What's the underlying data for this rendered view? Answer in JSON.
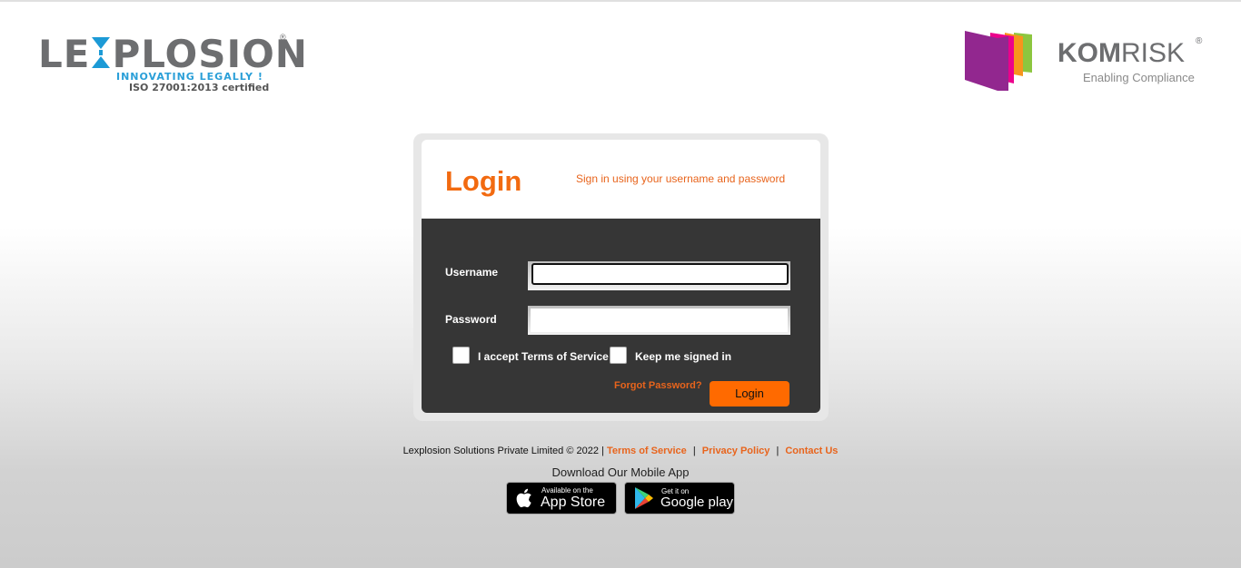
{
  "branding": {
    "lexplosion": {
      "word_left": "LE",
      "word_right": "PLOSION",
      "registered": "®",
      "tagline": "INNOVATING LEGALLY !",
      "certification": "ISO 27001:2013 certified"
    },
    "komrisk": {
      "word_bold": "KOM",
      "word_regular": "RISK",
      "registered": "®",
      "tagline": "Enabling Compliance"
    }
  },
  "login": {
    "title": "Login",
    "subtitle": "Sign in using your username and password",
    "username_label": "Username",
    "username_value": "",
    "password_label": "Password",
    "password_value": "",
    "accept_terms_label": "I accept Terms of Service",
    "keep_signed_in_label": "Keep me signed in",
    "forgot_password": "Forgot Password?",
    "submit_label": "Login"
  },
  "footer": {
    "copyright": "Lexplosion Solutions Private Limited © 2022 |",
    "terms": "Terms of Service",
    "privacy": "Privacy Policy",
    "contact": "Contact Us",
    "separator": "|"
  },
  "mobile": {
    "heading": "Download Our Mobile App",
    "app_store_small": "Available on the",
    "app_store_big": "App Store",
    "google_small": "Get it on",
    "google_big": "Google play"
  },
  "colors": {
    "accent": "#f26a10",
    "button": "#ff6a00",
    "panel": "#363636"
  },
  "icons": [
    "apple-icon",
    "google-play-icon"
  ]
}
